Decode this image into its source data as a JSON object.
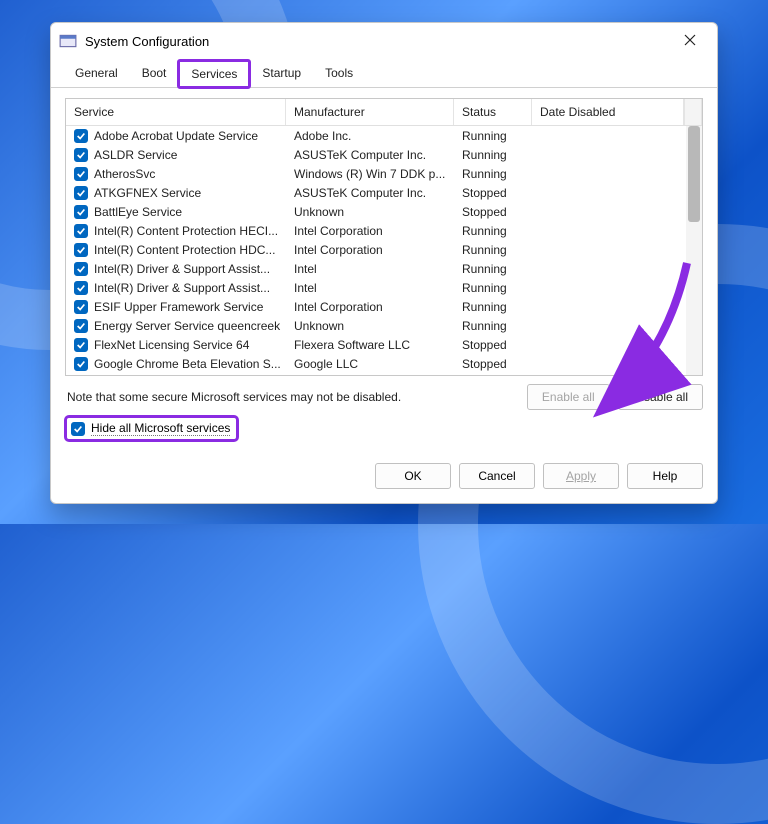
{
  "window": {
    "title": "System Configuration"
  },
  "tabs": {
    "items": [
      {
        "label": "General"
      },
      {
        "label": "Boot"
      },
      {
        "label": "Services"
      },
      {
        "label": "Startup"
      },
      {
        "label": "Tools"
      }
    ],
    "active_index": 2
  },
  "table": {
    "columns": {
      "service": "Service",
      "manufacturer": "Manufacturer",
      "status": "Status",
      "date_disabled": "Date Disabled"
    },
    "rows": [
      {
        "checked": true,
        "service": "Adobe Acrobat Update Service",
        "manufacturer": "Adobe Inc.",
        "status": "Running",
        "date_disabled": ""
      },
      {
        "checked": true,
        "service": "ASLDR Service",
        "manufacturer": "ASUSTeK Computer Inc.",
        "status": "Running",
        "date_disabled": ""
      },
      {
        "checked": true,
        "service": "AtherosSvc",
        "manufacturer": "Windows (R) Win 7 DDK p...",
        "status": "Running",
        "date_disabled": ""
      },
      {
        "checked": true,
        "service": "ATKGFNEX Service",
        "manufacturer": "ASUSTeK Computer Inc.",
        "status": "Stopped",
        "date_disabled": ""
      },
      {
        "checked": true,
        "service": "BattlEye Service",
        "manufacturer": "Unknown",
        "status": "Stopped",
        "date_disabled": ""
      },
      {
        "checked": true,
        "service": "Intel(R) Content Protection HECI...",
        "manufacturer": "Intel Corporation",
        "status": "Running",
        "date_disabled": ""
      },
      {
        "checked": true,
        "service": "Intel(R) Content Protection HDC...",
        "manufacturer": "Intel Corporation",
        "status": "Running",
        "date_disabled": ""
      },
      {
        "checked": true,
        "service": "Intel(R) Driver & Support Assist...",
        "manufacturer": "Intel",
        "status": "Running",
        "date_disabled": ""
      },
      {
        "checked": true,
        "service": "Intel(R) Driver & Support Assist...",
        "manufacturer": "Intel",
        "status": "Running",
        "date_disabled": ""
      },
      {
        "checked": true,
        "service": "ESIF Upper Framework Service",
        "manufacturer": "Intel Corporation",
        "status": "Running",
        "date_disabled": ""
      },
      {
        "checked": true,
        "service": "Energy Server Service queencreek",
        "manufacturer": "Unknown",
        "status": "Running",
        "date_disabled": ""
      },
      {
        "checked": true,
        "service": "FlexNet Licensing Service 64",
        "manufacturer": "Flexera Software LLC",
        "status": "Stopped",
        "date_disabled": ""
      },
      {
        "checked": true,
        "service": "Google Chrome Beta Elevation S...",
        "manufacturer": "Google LLC",
        "status": "Stopped",
        "date_disabled": ""
      }
    ]
  },
  "note": "Note that some secure Microsoft services may not be disabled.",
  "buttons": {
    "enable_all": "Enable all",
    "disable_all": "Disable all",
    "ok": "OK",
    "cancel": "Cancel",
    "apply": "Apply",
    "help": "Help"
  },
  "hide_checkbox": {
    "label": "Hide all Microsoft services",
    "checked": true
  },
  "annotation": {
    "color": "#8a2be2"
  }
}
